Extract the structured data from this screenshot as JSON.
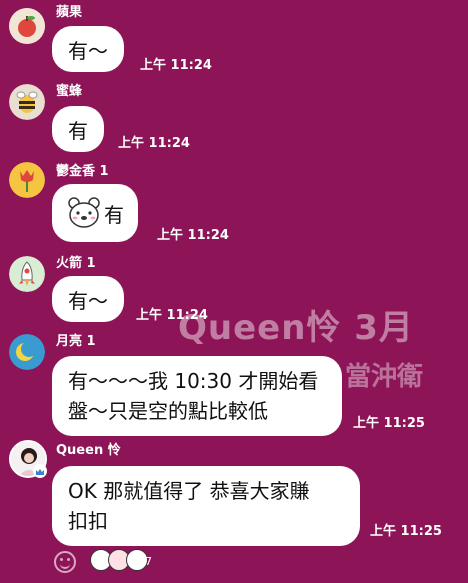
{
  "messages": [
    {
      "sender": "蘋果",
      "text": "有～",
      "time": "上午 11:24",
      "avatar": "apple-icon"
    },
    {
      "sender": "蜜蜂",
      "text": "有",
      "time": "上午 11:24",
      "avatar": "bee-icon"
    },
    {
      "sender": "鬱金香 1",
      "text": "有",
      "time": "上午 11:24",
      "avatar": "tulip-icon",
      "sticker": "bear-face-icon"
    },
    {
      "sender": "火箭 1",
      "text": "有～",
      "time": "上午 11:24",
      "avatar": "rocket-icon"
    },
    {
      "sender": "月亮 1",
      "lines": [
        "有～～～我 10:30 才開始看",
        "盤～只是空的點比較低"
      ],
      "time": "上午 11:25",
      "avatar": "moon-icon"
    },
    {
      "sender": "Queen 怜",
      "lines": [
        "OK 那就值得了 恭喜大家賺",
        "扣扣"
      ],
      "time": "上午 11:25",
      "avatar": "profile-photo-avatar"
    }
  ],
  "watermark": {
    "line1": "Queen怜   3月",
    "line2": "當沖衛"
  },
  "reactions": {
    "count": "7"
  },
  "colors": {
    "background": "#8e1458",
    "bubble": "#ffffff"
  }
}
